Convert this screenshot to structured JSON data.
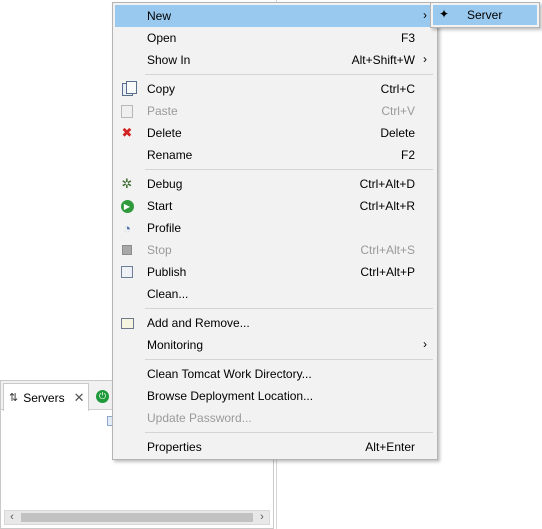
{
  "servers_view": {
    "tab_label": "Servers",
    "tab_icon": "servers-view-icon",
    "close_icon": "close-icon",
    "start_icon": "start-server-icon"
  },
  "context_menu": {
    "items": [
      {
        "label": "New",
        "shortcut": "",
        "submenu": true,
        "icon": "",
        "disabled": false,
        "highlighted": true
      },
      {
        "label": "Open",
        "shortcut": "F3",
        "submenu": false,
        "icon": "",
        "disabled": false
      },
      {
        "label": "Show In",
        "shortcut": "Alt+Shift+W",
        "submenu": true,
        "icon": "",
        "disabled": false
      },
      {
        "label": "Copy",
        "shortcut": "Ctrl+C",
        "submenu": false,
        "icon": "copy-icon",
        "disabled": false
      },
      {
        "label": "Paste",
        "shortcut": "Ctrl+V",
        "submenu": false,
        "icon": "paste-icon",
        "disabled": true
      },
      {
        "label": "Delete",
        "shortcut": "Delete",
        "submenu": false,
        "icon": "delete-icon",
        "disabled": false
      },
      {
        "label": "Rename",
        "shortcut": "F2",
        "submenu": false,
        "icon": "",
        "disabled": false
      },
      {
        "label": "Debug",
        "shortcut": "Ctrl+Alt+D",
        "submenu": false,
        "icon": "debug-icon",
        "disabled": false
      },
      {
        "label": "Start",
        "shortcut": "Ctrl+Alt+R",
        "submenu": false,
        "icon": "start-icon",
        "disabled": false
      },
      {
        "label": "Profile",
        "shortcut": "",
        "submenu": false,
        "icon": "profile-icon",
        "disabled": false
      },
      {
        "label": "Stop",
        "shortcut": "Ctrl+Alt+S",
        "submenu": false,
        "icon": "stop-icon",
        "disabled": true
      },
      {
        "label": "Publish",
        "shortcut": "Ctrl+Alt+P",
        "submenu": false,
        "icon": "publish-icon",
        "disabled": false
      },
      {
        "label": "Clean...",
        "shortcut": "",
        "submenu": false,
        "icon": "",
        "disabled": false
      },
      {
        "label": "Add and Remove...",
        "shortcut": "",
        "submenu": false,
        "icon": "add-remove-icon",
        "disabled": false
      },
      {
        "label": "Monitoring",
        "shortcut": "",
        "submenu": true,
        "icon": "",
        "disabled": false
      },
      {
        "label": "Clean Tomcat Work Directory...",
        "shortcut": "",
        "submenu": false,
        "icon": "",
        "disabled": false
      },
      {
        "label": "Browse Deployment Location...",
        "shortcut": "",
        "submenu": false,
        "icon": "",
        "disabled": false
      },
      {
        "label": "Update Password...",
        "shortcut": "",
        "submenu": false,
        "icon": "",
        "disabled": true
      },
      {
        "label": "Properties",
        "shortcut": "Alt+Enter",
        "submenu": false,
        "icon": "",
        "disabled": false
      }
    ],
    "submenu_arrow": "›"
  },
  "new_submenu": {
    "items": [
      {
        "label": "Server",
        "icon": "new-server-icon",
        "highlighted": true
      }
    ]
  },
  "colors": {
    "highlight": "#99c9ef",
    "menu_bg": "#f2f2f2",
    "disabled_text": "#9a9a9a",
    "delete_red": "#d22222",
    "start_green": "#2e9a3c"
  }
}
